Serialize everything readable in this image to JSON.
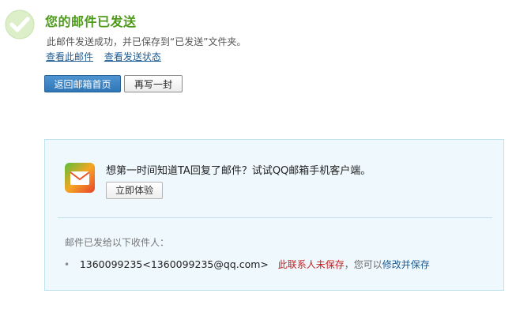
{
  "header": {
    "title": "您的邮件已发送",
    "subtitle": "此邮件发送成功，并已保存到“已发送”文件夹。",
    "link_view_mail": "查看此邮件",
    "link_view_status": "查看发送状态"
  },
  "actions": {
    "back_to_inbox": "返回邮箱首页",
    "write_another": "再写一封"
  },
  "promo": {
    "text": "想第一时间知道TA回复了邮件？试试QQ邮箱手机客户端。",
    "button": "立即体验"
  },
  "recipients": {
    "label": "邮件已发给以下收件人：",
    "items": [
      {
        "email": "1360099235<1360099235@qq.com>",
        "status": "此联系人未保存",
        "prompt": "，您可以",
        "action": "修改并保存"
      }
    ]
  },
  "colors": {
    "title": "#4d9a1a",
    "link": "#1d5c94",
    "primary_button": "#2f76b8",
    "panel_bg": "#eef8fd",
    "warning": "#c21e1e"
  },
  "icons": {
    "success": "checkmark-circle-icon",
    "app": "qq-mail-envelope-icon",
    "bullet": "bullet-icon"
  }
}
